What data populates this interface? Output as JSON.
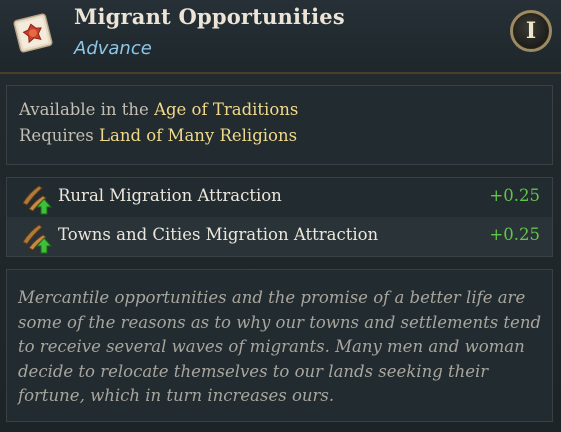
{
  "header": {
    "title": "Migrant Opportunities",
    "subtitle": "Advance",
    "icon": "parchment-seal-icon",
    "tier_badge": "I"
  },
  "requirements": {
    "line1_prefix": "Available in the ",
    "line1_value": "Age of Traditions",
    "line2_prefix": "Requires ",
    "line2_value": "Land of Many Religions"
  },
  "modifiers": [
    {
      "label": "Rural Migration Attraction",
      "value": "+0.25",
      "icon": "migration-attraction-up-icon"
    },
    {
      "label": "Towns and Cities Migration Attraction",
      "value": "+0.25",
      "icon": "migration-attraction-up-icon"
    }
  ],
  "description": "Mercantile opportunities and the promise of a better life are some of the reasons as to why our towns and settlements tend to receive several waves of migrants. Many men and woman decide to relocate themselves to our lands seeking their fortune, which in turn increases ours.",
  "colors": {
    "title": "#ece4d6",
    "subtitle": "#8ec6e6",
    "highlight": "#f0d98a",
    "positive": "#63c44a",
    "description": "#a8a59d"
  }
}
